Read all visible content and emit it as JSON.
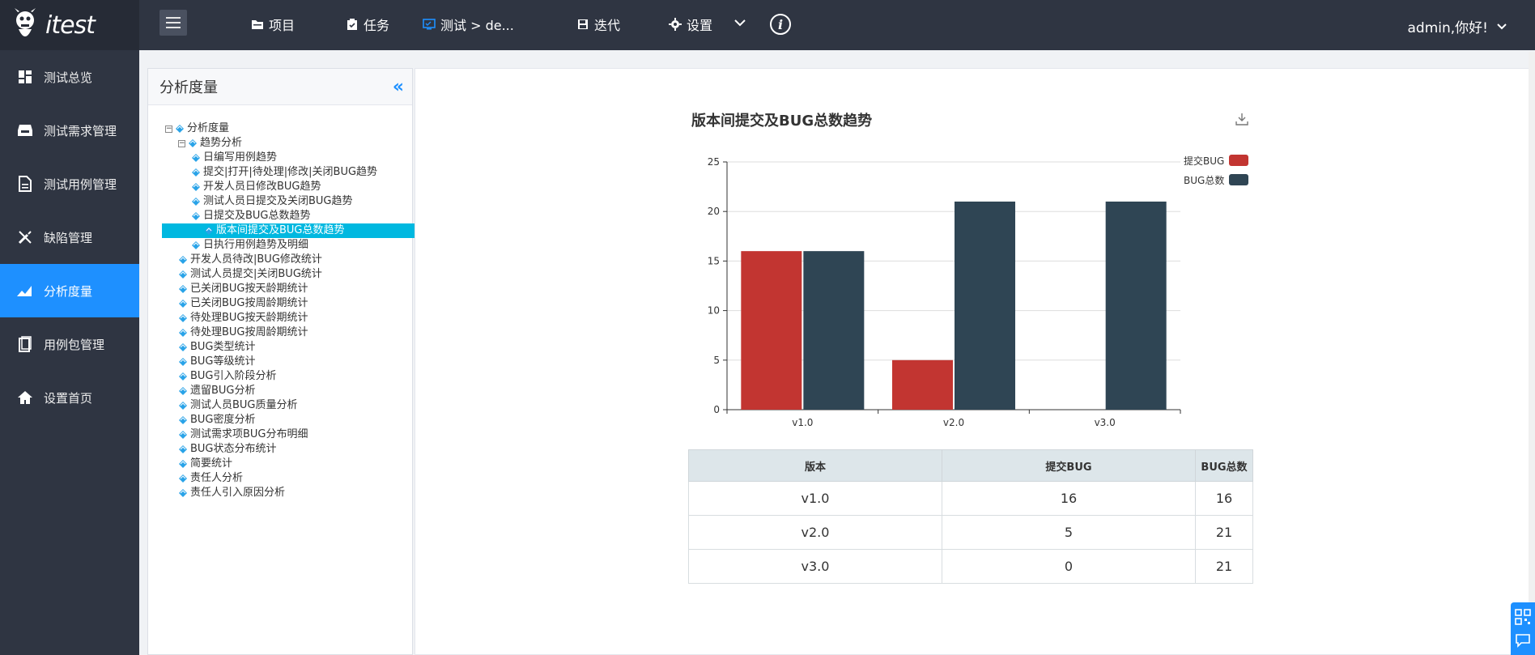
{
  "app": {
    "brand": "itest"
  },
  "topnav": [
    {
      "label": "项目",
      "icon": "folder-icon"
    },
    {
      "label": "任务",
      "icon": "clipboard-icon"
    },
    {
      "label": "测试 > de...",
      "icon": "monitor-icon"
    },
    {
      "label": "迭代",
      "icon": "save-icon"
    },
    {
      "label": "设置",
      "icon": "gear-icon"
    }
  ],
  "user": {
    "greeting": "admin,你好!"
  },
  "sidebar": {
    "items": [
      {
        "label": "测试总览",
        "icon": "dashboard-icon"
      },
      {
        "label": "测试需求管理",
        "icon": "inbox-icon"
      },
      {
        "label": "测试用例管理",
        "icon": "document-icon"
      },
      {
        "label": "缺陷管理",
        "icon": "tools-icon"
      },
      {
        "label": "分析度量",
        "icon": "chart-icon",
        "active": true
      },
      {
        "label": "用例包管理",
        "icon": "package-icon"
      },
      {
        "label": "设置首页",
        "icon": "home-icon"
      }
    ]
  },
  "tree": {
    "title": "分析度量",
    "root": "分析度量",
    "group": "趋势分析",
    "trend_items": [
      "日编写用例趋势",
      "提交|打开|待处理|修改|关闭BUG趋势",
      "开发人员日修改BUG趋势",
      "测试人员日提交及关闭BUG趋势",
      "日提交及BUG总数趋势",
      "版本间提交及BUG总数趋势",
      "日执行用例趋势及明细"
    ],
    "selected": "版本间提交及BUG总数趋势",
    "items": [
      "开发人员待改|BUG修改统计",
      "测试人员提交|关闭BUG统计",
      "已关闭BUG按天龄期统计",
      "已关闭BUG按周龄期统计",
      "待处理BUG按天龄期统计",
      "待处理BUG按周龄期统计",
      "BUG类型统计",
      "BUG等级统计",
      "BUG引入阶段分析",
      "遗留BUG分析",
      "测试人员BUG质量分析",
      "BUG密度分析",
      "测试需求项BUG分布明细",
      "BUG状态分布统计",
      "简要统计",
      "责任人分析",
      "责任人引入原因分析"
    ]
  },
  "chart_data": {
    "type": "bar",
    "title": "版本间提交及BUG总数趋势",
    "categories": [
      "v1.0",
      "v2.0",
      "v3.0"
    ],
    "series": [
      {
        "name": "提交BUG",
        "values": [
          16,
          5,
          0
        ],
        "color": "#c23531"
      },
      {
        "name": "BUG总数",
        "values": [
          16,
          21,
          21
        ],
        "color": "#2f4554"
      }
    ],
    "ylim": [
      0,
      25
    ],
    "yticks": [
      0,
      5,
      10,
      15,
      20,
      25
    ],
    "grid": true,
    "legend": "top-right"
  },
  "table": {
    "headers": [
      "版本",
      "提交BUG",
      "BUG总数"
    ],
    "rows": [
      [
        "v1.0",
        "16",
        "16"
      ],
      [
        "v2.0",
        "5",
        "21"
      ],
      [
        "v3.0",
        "0",
        "21"
      ]
    ]
  }
}
